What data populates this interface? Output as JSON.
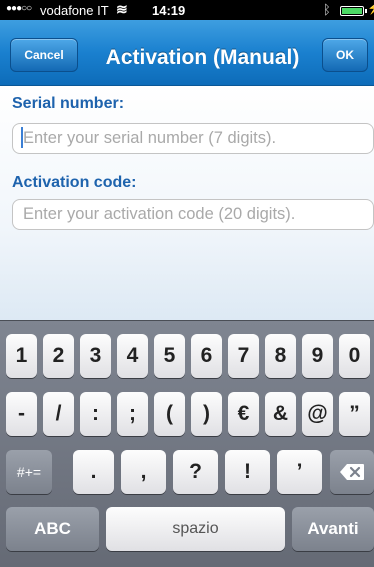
{
  "status_bar": {
    "carrier": "vodafone IT",
    "time": "14:19"
  },
  "nav": {
    "cancel_label": "Cancel",
    "title": "Activation (Manual)",
    "ok_label": "OK"
  },
  "form": {
    "serial_label": "Serial number:",
    "serial_placeholder": "Enter your serial number (7 digits).",
    "activation_label": "Activation code:",
    "activation_placeholder": "Enter your activation code (20 digits)."
  },
  "keyboard": {
    "row1": [
      "1",
      "2",
      "3",
      "4",
      "5",
      "6",
      "7",
      "8",
      "9",
      "0"
    ],
    "row2": [
      "-",
      "/",
      ":",
      ";",
      "(",
      ")",
      "€",
      "&",
      "@",
      "”"
    ],
    "symbols_toggle": "#+=",
    "row3": [
      ".",
      ",",
      "?",
      "!",
      "’"
    ],
    "backspace_icon": "backspace-icon",
    "abc_label": "ABC",
    "space_label": "spazio",
    "return_label": "Avanti"
  },
  "colors": {
    "nav_blue": "#1a80cf",
    "label_blue": "#1e63ad",
    "battery_green": "#4cd964"
  }
}
